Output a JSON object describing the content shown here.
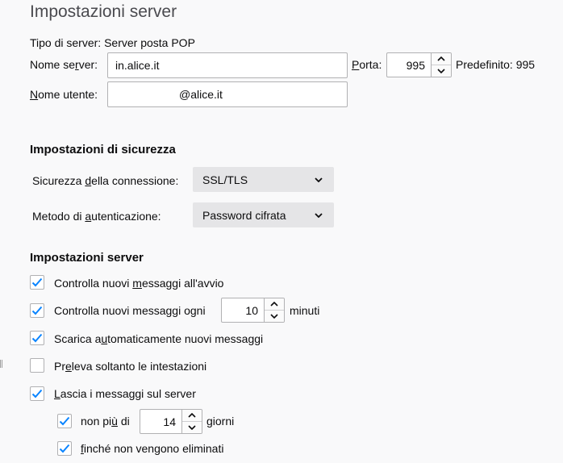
{
  "page_title": "Impostazioni server",
  "server_type": {
    "label": "Tipo di server:",
    "value": "Server posta POP"
  },
  "server_name": {
    "label_pre": "Nome se",
    "label_key": "r",
    "label_post": "ver:",
    "value": "in.alice.it"
  },
  "port": {
    "label_key": "P",
    "label_post": "orta:",
    "value": "995",
    "default_text": "Predefinito: 995"
  },
  "username": {
    "label_key": "N",
    "label_post": "ome utente:",
    "value": "@alice.it"
  },
  "security": {
    "heading": "Impostazioni di sicurezza",
    "connection": {
      "label_pre": "Sicurezza ",
      "label_key": "d",
      "label_post": "ella connessione:",
      "selected": "SSL/TLS"
    },
    "auth": {
      "label_pre": "Metodo di ",
      "label_key": "a",
      "label_post": "utenticazione:",
      "selected": "Password cifrata"
    }
  },
  "server_settings": {
    "heading": "Impostazioni server",
    "check_startup": {
      "label_pre": "Controlla nuovi ",
      "label_key": "m",
      "label_post": "essaggi all'avvio",
      "checked": true
    },
    "check_every": {
      "label_pre": "Controlla nuovi messaggi o",
      "label_key": "g",
      "label_post": "ni",
      "checked": true,
      "value": "10",
      "unit": "minuti"
    },
    "auto_download": {
      "label_pre": "Scarica a",
      "label_key": "u",
      "label_post": "tomaticamente nuovi messaggi",
      "checked": true
    },
    "headers_only": {
      "label_pre": "Pr",
      "label_key": "e",
      "label_post": "leva soltanto le intestazioni",
      "checked": false
    },
    "leave_on_server": {
      "label_pre": "",
      "label_key": "L",
      "label_post": "ascia i messaggi sul server",
      "checked": true
    },
    "max_days": {
      "label_pre": "non pi",
      "label_key": "ù",
      "label_post": " di",
      "checked": true,
      "value": "14",
      "unit": "giorni"
    },
    "until_deleted": {
      "label_pre": "",
      "label_key": "f",
      "label_post": "inché non vengono eliminati",
      "checked": true
    }
  },
  "colors": {
    "accent": "#0a84ff",
    "background": "#f9f9fa",
    "select_bg": "#e5e5e7"
  },
  "icons": {
    "check": "checkmark-icon",
    "up": "chevron-up-icon",
    "down": "chevron-down-icon"
  }
}
